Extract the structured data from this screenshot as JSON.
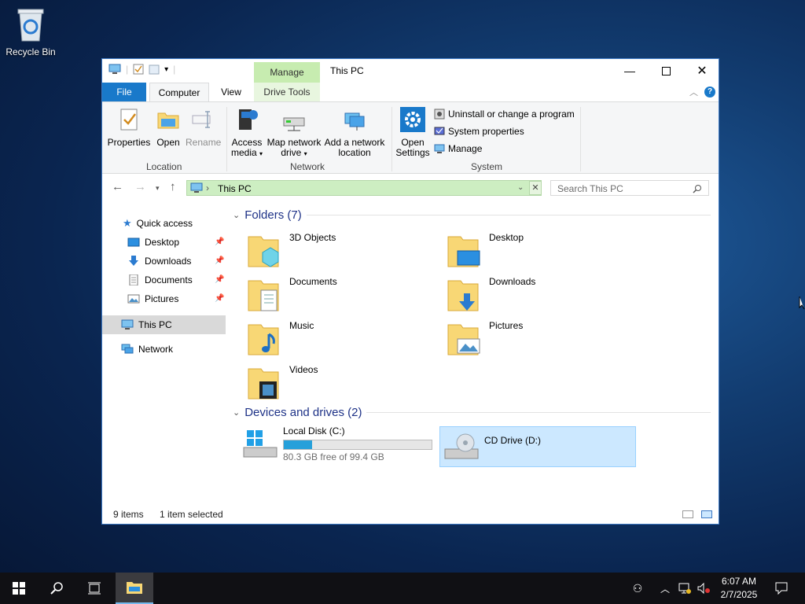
{
  "desktop": {
    "recycle_bin_label": "Recycle Bin"
  },
  "window": {
    "title": "This PC",
    "manage_label": "Manage"
  },
  "tabs": {
    "file": "File",
    "computer": "Computer",
    "view": "View",
    "drive_tools": "Drive Tools"
  },
  "ribbon": {
    "location": {
      "properties": "Properties",
      "open": "Open",
      "rename": "Rename",
      "group_label": "Location"
    },
    "network": {
      "access_media_line1": "Access",
      "access_media_line2": "media",
      "map_drive_line1": "Map network",
      "map_drive_line2": "drive",
      "add_location_line1": "Add a network",
      "add_location_line2": "location",
      "group_label": "Network"
    },
    "system": {
      "open_settings_line1": "Open",
      "open_settings_line2": "Settings",
      "uninstall": "Uninstall or change a program",
      "system_properties": "System properties",
      "manage": "Manage",
      "group_label": "System"
    }
  },
  "address": {
    "path": "This PC",
    "search_placeholder": "Search This PC"
  },
  "nav": {
    "quick_access": "Quick access",
    "desktop": "Desktop",
    "downloads": "Downloads",
    "documents": "Documents",
    "pictures": "Pictures",
    "this_pc": "This PC",
    "network": "Network"
  },
  "folders_section": {
    "title": "Folders (7)"
  },
  "folders": [
    "3D Objects",
    "Desktop",
    "Documents",
    "Downloads",
    "Music",
    "Pictures",
    "Videos"
  ],
  "drives_section": {
    "title": "Devices and drives (2)"
  },
  "drives": [
    {
      "name": "Local Disk (C:)",
      "free_text": "80.3 GB free of 99.4 GB",
      "used_fraction": 0.19
    },
    {
      "name": "CD Drive (D:)"
    }
  ],
  "status": {
    "items": "9 items",
    "selected": "1 item selected"
  },
  "taskbar": {
    "time": "6:07 AM",
    "date": "2/7/2025"
  },
  "colors": {
    "accent": "#1979ca",
    "selection": "#cce8ff",
    "address_bg": "#cdeec2",
    "manage_bg": "#c7ecb0",
    "bar_fill": "#26a0da"
  }
}
